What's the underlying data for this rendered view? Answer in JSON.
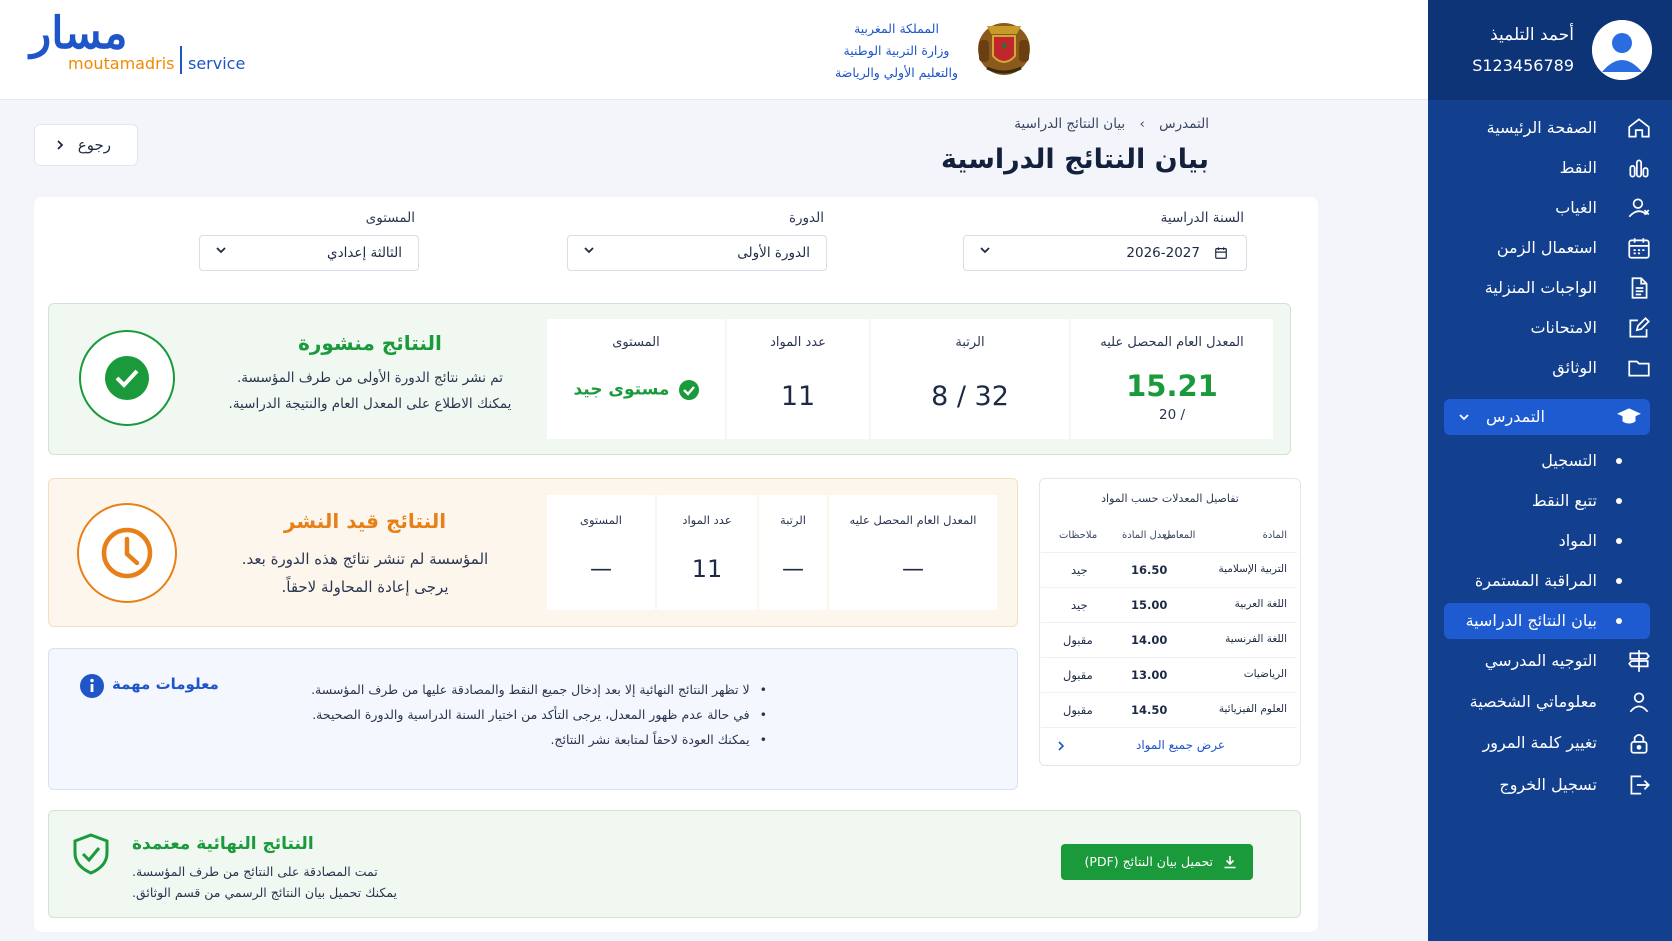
{
  "header": {
    "logo_ar": "مسار",
    "logo_sub": "moutamadris",
    "logo_service": "service",
    "ministry": [
      "المملكة المغربية",
      "وزارة التربية الوطنية",
      "والتعليم الأولي والرياضة"
    ]
  },
  "user": {
    "name": "أحمد التلميذ",
    "id": "S123456789"
  },
  "sidebar": {
    "items": [
      {
        "label": "الصفحة الرئيسية",
        "icon": "home-icon"
      },
      {
        "label": "النقط",
        "icon": "chart-icon"
      },
      {
        "label": "الغياب",
        "icon": "user-x-icon"
      },
      {
        "label": "استعمال الزمن",
        "icon": "calendar-icon"
      },
      {
        "label": "الواجبات المنزلية",
        "icon": "document-icon"
      },
      {
        "label": "الامتحانات",
        "icon": "edit-icon"
      },
      {
        "label": "الوثائق",
        "icon": "folder-icon"
      }
    ],
    "group": {
      "label": "التمدرس",
      "icon": "graduation-cap-icon"
    },
    "sub_items": [
      "التسجيل",
      "تتبع النقط",
      "المواد",
      "المراقبة المستمرة",
      "بيان النتائج الدراسية"
    ],
    "bottom_items": [
      {
        "label": "التوجيه المدرسي",
        "icon": "signpost-icon"
      },
      {
        "label": "معلوماتي الشخصية",
        "icon": "user-icon"
      },
      {
        "label": "تغيير كلمة المرور",
        "icon": "lock-icon"
      },
      {
        "label": "تسجيل الخروج",
        "icon": "logout-icon"
      }
    ]
  },
  "breadcrumb": {
    "parent": "التمدرس",
    "sep": "›",
    "current": "بيان النتائج الدراسية"
  },
  "page_title": "بيان النتائج الدراسية",
  "back_label": "رجوع",
  "filters": {
    "year": {
      "label": "السنة الدراسية",
      "value": "2026-2027"
    },
    "session": {
      "label": "الدورة",
      "value": "الدورة الأولى"
    },
    "level": {
      "label": "المستوى",
      "value": "الثالثة إعدادي"
    }
  },
  "published": {
    "title": "النتائج منشورة",
    "line1": "تم نشر نتائج الدورة الأولى من طرف المؤسسة.",
    "line2": "يمكنك الاطلاع على المعدل العام والنتيجة الدراسية.",
    "avg_label": "المعدل العام المحصل عليه",
    "avg_value": "15.21",
    "avg_max": "/ 20",
    "rank_label": "الرتبة",
    "rank_value": "8 / 32",
    "subjects_label": "عدد المواد",
    "subjects_value": "11",
    "level_label": "المستوى",
    "level_value": "مستوى جيد"
  },
  "pending": {
    "title": "النتائج قيد النشر",
    "line1": "المؤسسة لم تنشر نتائج هذه الدورة بعد.",
    "line2": "يرجى إعادة المحاولة لاحقاً.",
    "avg_label": "المعدل العام المحصل عليه",
    "avg_value": "—",
    "rank_label": "الرتبة",
    "rank_value": "—",
    "subjects_label": "عدد المواد",
    "subjects_value": "11",
    "level_label": "المستوى",
    "level_value": "—"
  },
  "details": {
    "title": "تفاصيل المعدلات حسب المواد",
    "columns": [
      "المادة",
      "المعامل",
      "معدل المادة",
      "ملاحظات"
    ],
    "rows": [
      {
        "subject": "التربية الإسلامية",
        "avg": "16.50",
        "note": "جيد"
      },
      {
        "subject": "اللغة العربية",
        "avg": "15.00",
        "note": "جيد"
      },
      {
        "subject": "اللغة الفرنسية",
        "avg": "14.00",
        "note": "مقبول"
      },
      {
        "subject": "الرياضيات",
        "avg": "13.00",
        "note": "مقبول"
      },
      {
        "subject": "العلوم الفيزيائية",
        "avg": "14.50",
        "note": "مقبول"
      }
    ],
    "view_all": "عرض جميع المواد"
  },
  "info": {
    "title": "معلومات مهمة",
    "items": [
      "لا تظهر النتائج النهائية إلا بعد إدخال جميع النقط والمصادقة عليها من طرف المؤسسة.",
      "في حالة عدم ظهور المعدل، يرجى التأكد من اختيار السنة الدراسية والدورة الصحيحة.",
      "يمكنك العودة لاحقاً لمتابعة نشر النتائج."
    ]
  },
  "final": {
    "title": "النتائج النهائية معتمدة",
    "line1": "تمت المصادقة على النتائج من طرف المؤسسة.",
    "line2": "يمكنك تحميل بيان النتائج الرسمي من قسم الوثائق.",
    "button": "تحميل بيان النتائج (PDF)"
  },
  "colors": {
    "primary": "#123f8e",
    "accent": "#1e5bd1",
    "success": "#1a9a3a",
    "warning": "#e8801a",
    "info": "#1e55c8"
  }
}
